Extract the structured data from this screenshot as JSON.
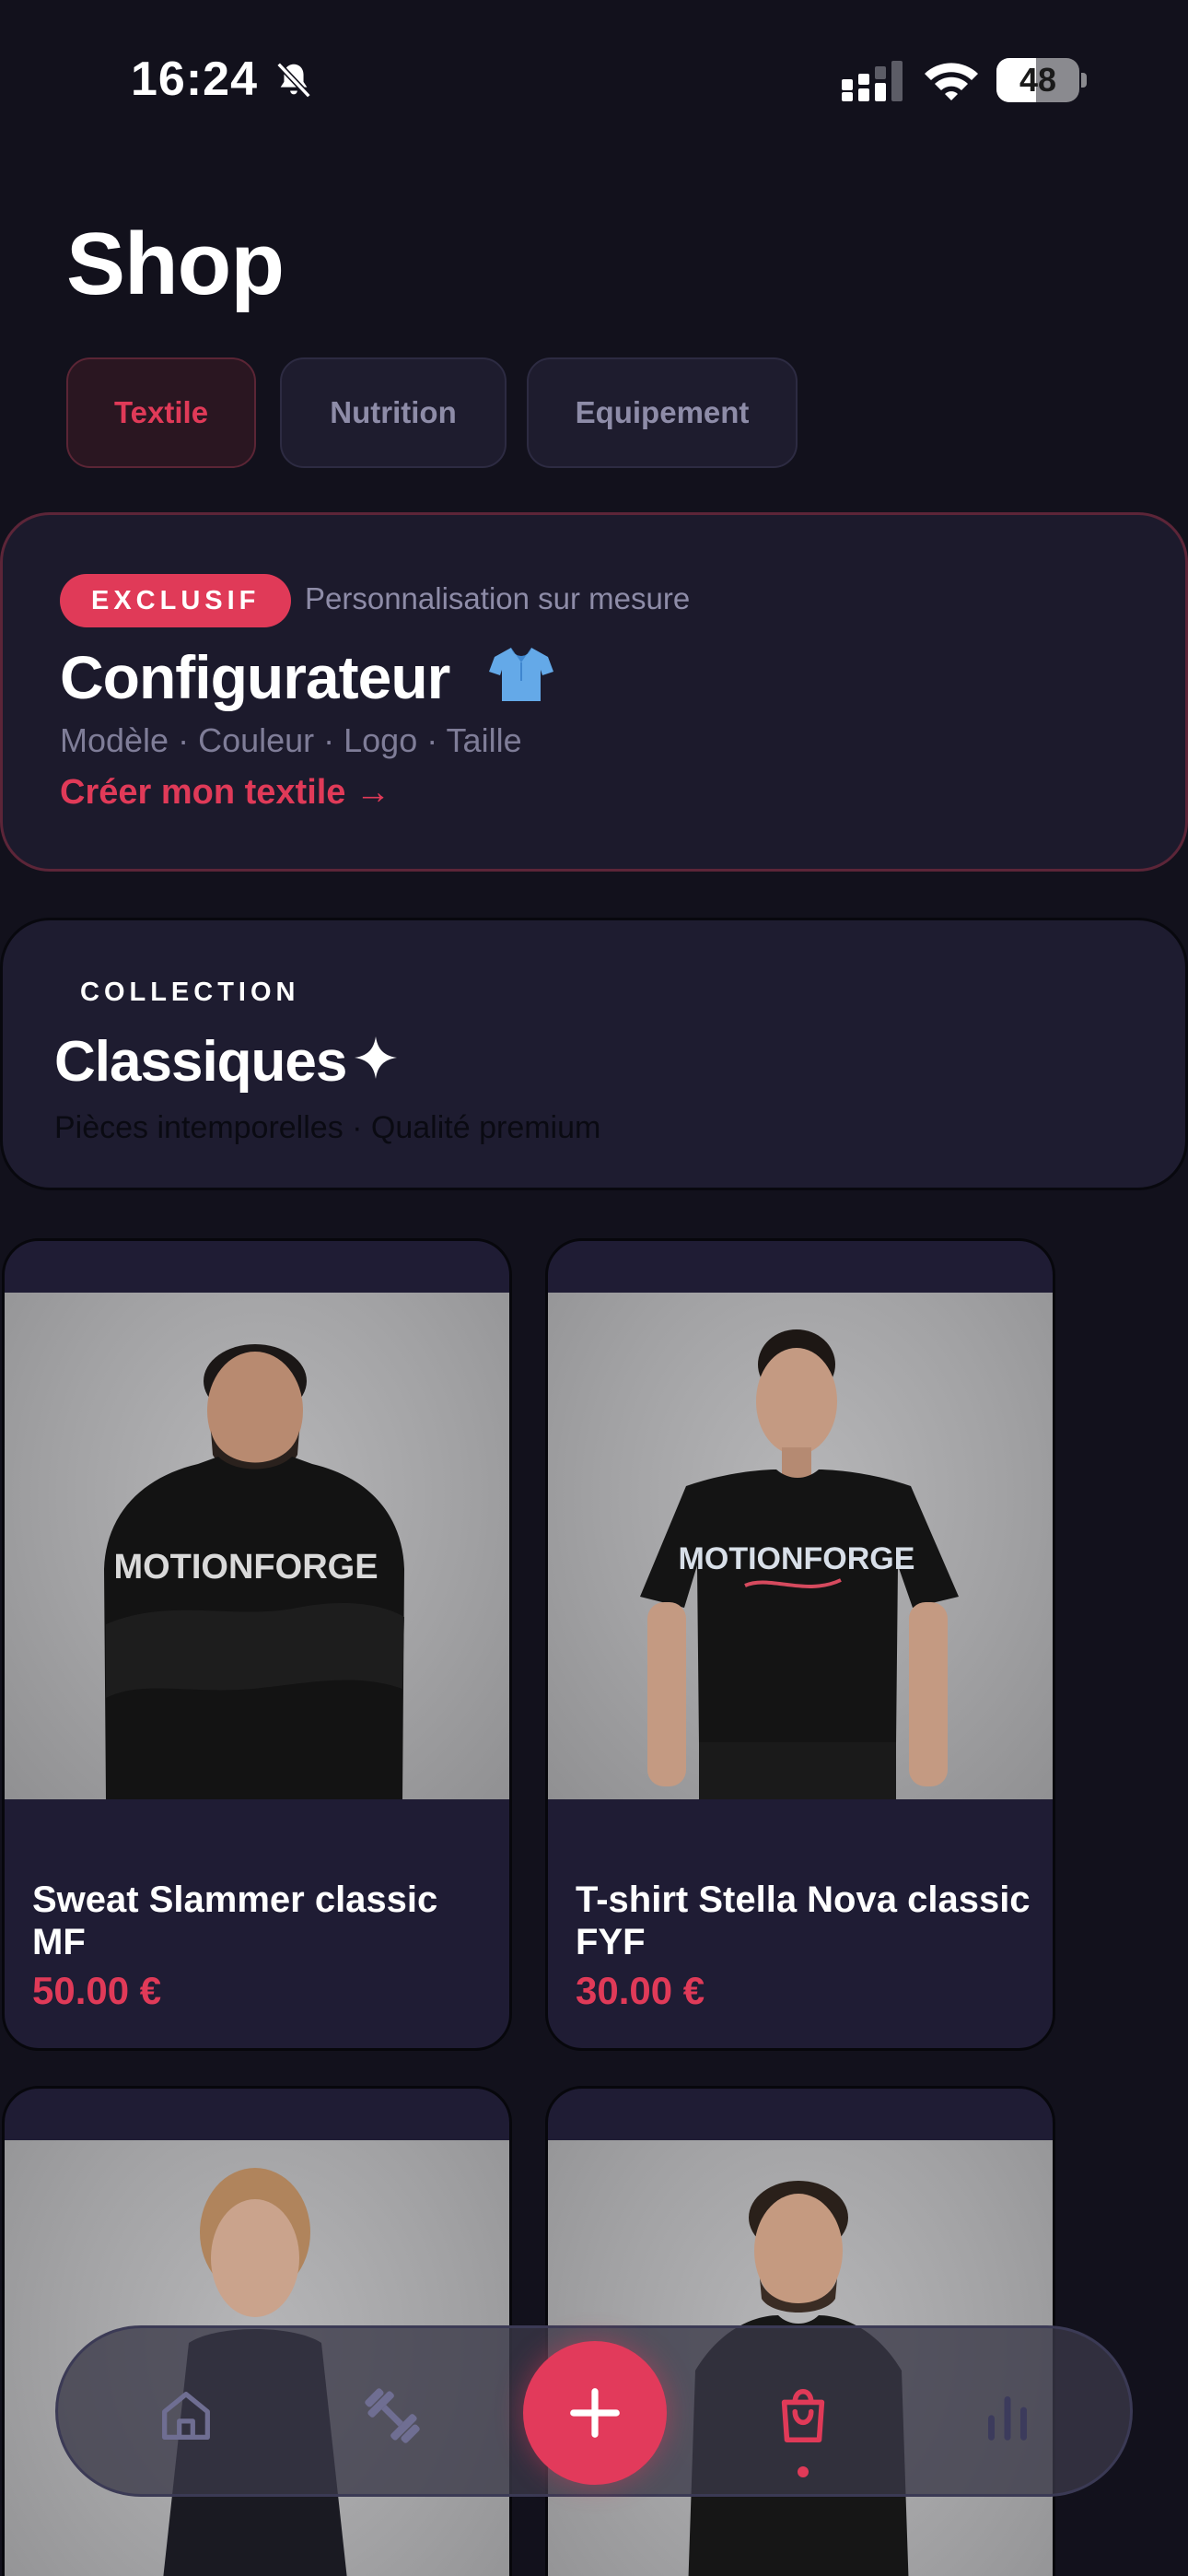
{
  "status_bar": {
    "time": "16:24",
    "battery_level": "48",
    "battery_fraction": 0.48
  },
  "header": {
    "title": "Shop"
  },
  "tabs": [
    {
      "label": "Textile",
      "active": true
    },
    {
      "label": "Nutrition",
      "active": false
    },
    {
      "label": "Equipement",
      "active": false
    }
  ],
  "configurator": {
    "badge": "EXCLUSIF",
    "tagline": "Personnalisation sur mesure",
    "title": "Configurateur",
    "icon": "tshirt-icon",
    "options": "Modèle · Couleur · Logo · Taille",
    "cta": "Créer mon textile →"
  },
  "collection": {
    "label": "COLLECTION",
    "title": "Classiques",
    "icon": "sparkle-icon",
    "subtitle": "Pièces intemporelles · Qualité premium"
  },
  "products": [
    {
      "name": "Sweat Slammer classic MF",
      "price": "50.00 €",
      "image": "man-in-black-hoodie-photo"
    },
    {
      "name": "T-shirt Stella Nova classic FYF",
      "price": "30.00 €",
      "image": "woman-in-black-tshirt-photo"
    },
    {
      "name": "",
      "price": "",
      "image": "woman-portrait-photo"
    },
    {
      "name": "",
      "price": "",
      "image": "man-in-hoodie-portrait-photo"
    }
  ],
  "bottom_nav": {
    "items": [
      {
        "icon": "home-icon",
        "active": false
      },
      {
        "icon": "dumbbell-icon",
        "active": false
      },
      {
        "icon": "add-icon",
        "active": false
      },
      {
        "icon": "shopping-bag-icon",
        "active": true
      },
      {
        "icon": "bar-chart-icon",
        "active": false
      }
    ]
  },
  "colors": {
    "background": "#12111c",
    "card": "#1e1c30",
    "accent": "#e03a58",
    "muted_text": "#8e8ca8",
    "brand_print": "MOTIONFORGE"
  }
}
